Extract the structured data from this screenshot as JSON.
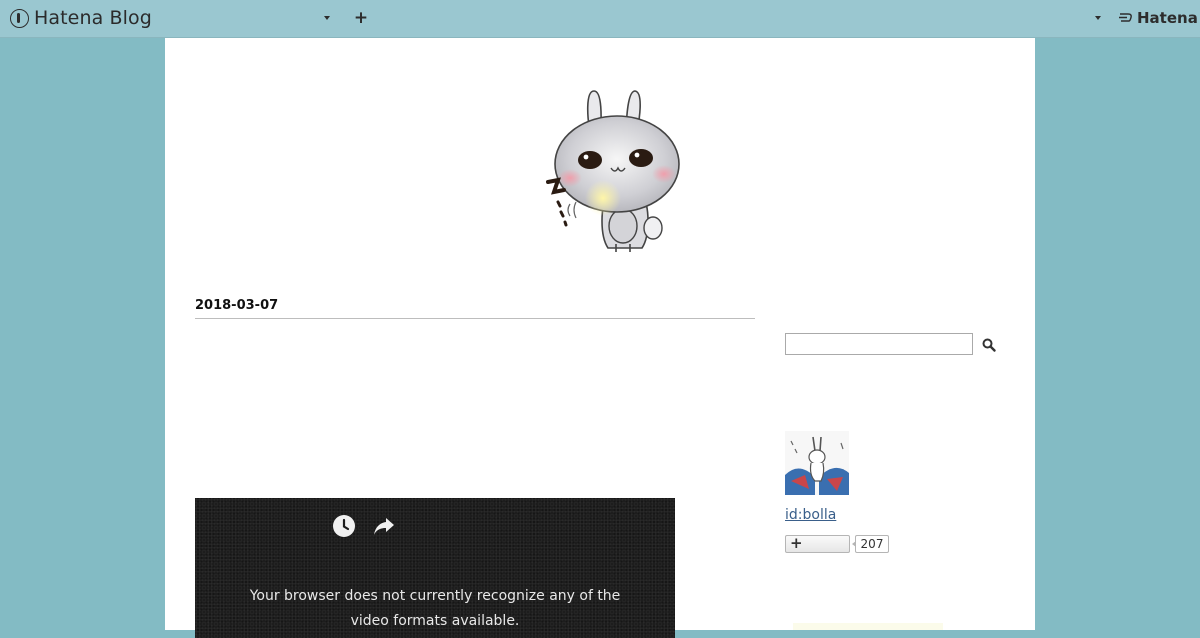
{
  "globalbar": {
    "brand": "Hatena Blog",
    "company": "Hatena"
  },
  "entry": {
    "date": "2018-03-07"
  },
  "video": {
    "message": "Your browser does not currently recognize any of the video formats available."
  },
  "sidebar": {
    "search_placeholder": "",
    "user_id": "id:bolla",
    "follower_count": "207"
  }
}
